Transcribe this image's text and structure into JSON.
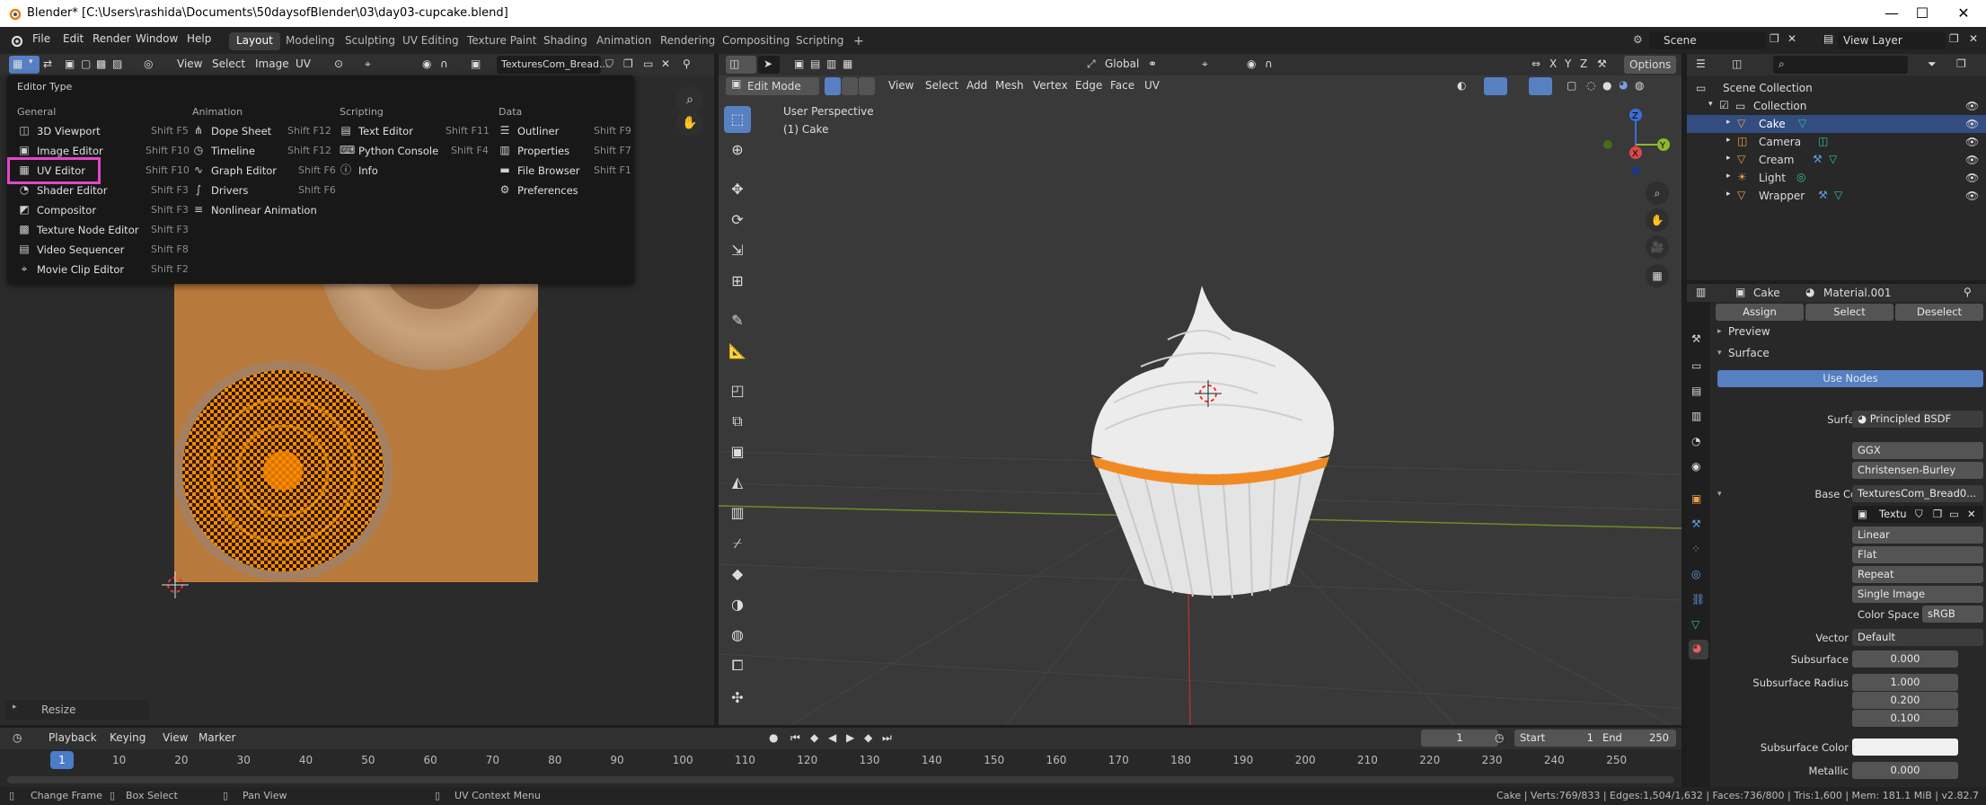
{
  "window": {
    "title": "Blender* [C:\\Users\\rashida\\Documents\\50daysofBlender\\03\\day03-cupcake.blend]",
    "minimize": "—",
    "maximize": "☐",
    "close": "✕"
  },
  "menus": [
    "File",
    "Edit",
    "Render",
    "Window",
    "Help"
  ],
  "workspaces": [
    "Layout",
    "Modeling",
    "Sculpting",
    "UV Editing",
    "Texture Paint",
    "Shading",
    "Animation",
    "Rendering",
    "Compositing",
    "Scripting"
  ],
  "active_workspace": "Layout",
  "scene": {
    "name": "Scene",
    "view_layer": "View Layer"
  },
  "uv_header": {
    "menus": [
      "View",
      "Select",
      "Image",
      "UV"
    ],
    "image_name": "TexturesCom_Bread..."
  },
  "editor_menu": {
    "title": "Editor Type",
    "categories": {
      "general": {
        "title": "General",
        "items": [
          {
            "label": "3D Viewport",
            "shortcut": "Shift F5"
          },
          {
            "label": "Image Editor",
            "shortcut": "Shift F10"
          },
          {
            "label": "UV Editor",
            "shortcut": "Shift F10"
          },
          {
            "label": "Shader Editor",
            "shortcut": "Shift F3"
          },
          {
            "label": "Compositor",
            "shortcut": "Shift F3"
          },
          {
            "label": "Texture Node Editor",
            "shortcut": "Shift F3"
          },
          {
            "label": "Video Sequencer",
            "shortcut": "Shift F8"
          },
          {
            "label": "Movie Clip Editor",
            "shortcut": "Shift F2"
          }
        ]
      },
      "animation": {
        "title": "Animation",
        "items": [
          {
            "label": "Dope Sheet",
            "shortcut": "Shift F12"
          },
          {
            "label": "Timeline",
            "shortcut": "Shift F12"
          },
          {
            "label": "Graph Editor",
            "shortcut": "Shift F6"
          },
          {
            "label": "Drivers",
            "shortcut": "Shift F6"
          },
          {
            "label": "Nonlinear Animation",
            "shortcut": ""
          }
        ]
      },
      "scripting": {
        "title": "Scripting",
        "items": [
          {
            "label": "Text Editor",
            "shortcut": "Shift F11"
          },
          {
            "label": "Python Console",
            "shortcut": "Shift F4"
          },
          {
            "label": "Info",
            "shortcut": ""
          }
        ]
      },
      "data": {
        "title": "Data",
        "items": [
          {
            "label": "Outliner",
            "shortcut": "Shift F9"
          },
          {
            "label": "Properties",
            "shortcut": "Shift F7"
          },
          {
            "label": "File Browser",
            "shortcut": "Shift F1"
          },
          {
            "label": "Preferences",
            "shortcut": ""
          }
        ]
      }
    }
  },
  "resize_panel": {
    "label": "Resize"
  },
  "viewport": {
    "mode": "Edit Mode",
    "menus": [
      "View",
      "Select",
      "Add",
      "Mesh",
      "Vertex",
      "Edge",
      "Face",
      "UV"
    ],
    "transform_orientation": "Global",
    "options": "Options",
    "overlay_line1": "User Perspective",
    "overlay_line2": "(1) Cake",
    "axes": {
      "x": "X",
      "y": "Y",
      "z": "Z"
    }
  },
  "outliner": {
    "root": "Scene Collection",
    "collection": "Collection",
    "objects": [
      "Cake",
      "Camera",
      "Cream",
      "Light",
      "Wrapper"
    ],
    "selected": "Cake"
  },
  "properties": {
    "object": "Cake",
    "material": "Material.001",
    "buttons": [
      "Assign",
      "Select",
      "Deselect"
    ],
    "preview": "Preview",
    "surface_panel": "Surface",
    "use_nodes": "Use Nodes",
    "rows": {
      "surface_label": "Surface",
      "surface_value": "Principled BSDF",
      "distribution": "GGX",
      "subsurface_method": "Christensen-Burley",
      "base_color_label": "Base Color",
      "base_color_value": "TexturesCom_Bread0...",
      "image_name_short": "Textu",
      "interpolation": "Linear",
      "projection": "Flat",
      "extension": "Repeat",
      "source": "Single Image",
      "color_space_label": "Color Space",
      "color_space_value": "sRGB",
      "vector_label": "Vector",
      "vector_value": "Default",
      "subsurface_label": "Subsurface",
      "subsurface_value": "0.000",
      "subsurface_radius_label": "Subsurface Radius",
      "subsurface_radius": [
        "1.000",
        "0.200",
        "0.100"
      ],
      "subsurface_color_label": "Subsurface Color",
      "metallic_label": "Metallic",
      "metallic_value": "0.000"
    }
  },
  "timeline": {
    "menus": [
      "Playback",
      "Keying",
      "View",
      "Marker"
    ],
    "current_frame": "1",
    "start_label": "Start",
    "start": "1",
    "end_label": "End",
    "end": "250",
    "ticks": [
      "1",
      "10",
      "20",
      "30",
      "40",
      "50",
      "60",
      "70",
      "80",
      "90",
      "100",
      "110",
      "120",
      "130",
      "140",
      "150",
      "160",
      "170",
      "180",
      "190",
      "200",
      "210",
      "220",
      "230",
      "240",
      "250"
    ]
  },
  "statusbar": {
    "change_frame": "Change Frame",
    "box_select": "Box Select",
    "pan_view": "Pan View",
    "context_menu": "UV Context Menu",
    "stats": "Cake | Verts:769/833 | Edges:1,504/1,632 | Faces:736/800 | Tris:1,600 | Mem: 181.1 MiB | v2.82.7"
  },
  "colors": {
    "accent": "#5680c2",
    "highlight": "#e646c8",
    "selection": "#334d80",
    "uv_bg": "#b87a3c"
  }
}
